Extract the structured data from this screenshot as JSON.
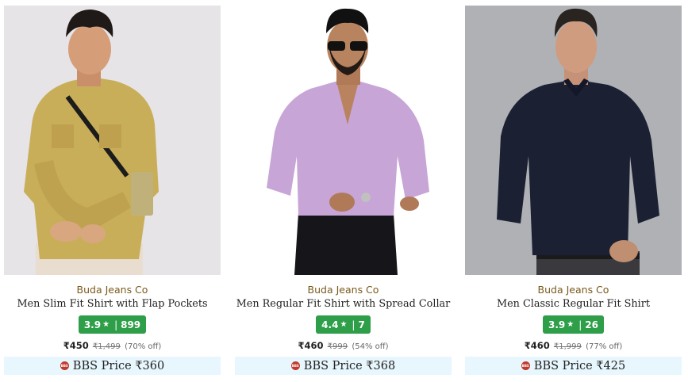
{
  "products": [
    {
      "image_alt": "Man wearing mustard slim fit shirt with flap pockets and crossbody bag",
      "brand": "Buda Jeans Co",
      "title": "Men Slim Fit Shirt with Flap Pockets",
      "rating": "3.9",
      "reviews": "899",
      "price": "₹450",
      "mrp": "₹1,499",
      "discount": "(70% off)",
      "bbs_label": "BBS Price ₹360"
    },
    {
      "image_alt": "Man wearing lavender regular fit shirt with spread collar and black trousers",
      "brand": "Buda Jeans Co",
      "title": "Men Regular Fit Shirt with Spread Collar",
      "rating": "4.4",
      "reviews": "7",
      "price": "₹460",
      "mrp": "₹999",
      "discount": "(54% off)",
      "bbs_label": "BBS Price ₹368"
    },
    {
      "image_alt": "Man wearing navy classic regular fit shirt",
      "brand": "Buda Jeans Co",
      "title": "Men Classic Regular Fit Shirt",
      "rating": "3.9",
      "reviews": "26",
      "price": "₹460",
      "mrp": "₹1,999",
      "discount": "(77% off)",
      "bbs_label": "BBS Price ₹425"
    }
  ],
  "icons": {
    "rating": "star-icon",
    "bbs": "bbs-badge-icon"
  },
  "colors": {
    "rating_bg": "#2e9e49",
    "brand": "#7a5a1d",
    "bbs_bg": "#e8f6fd",
    "bbs_icon": "#c0392b"
  }
}
